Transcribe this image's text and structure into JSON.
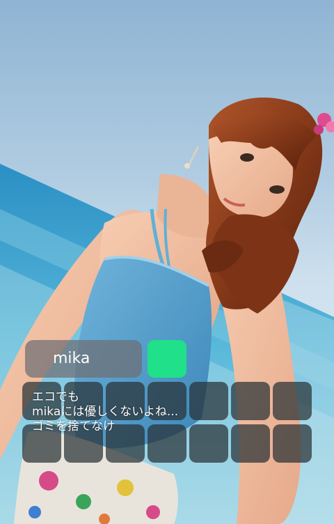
{
  "speaker": {
    "name": "mika"
  },
  "status_color": "#20e08a",
  "message": {
    "lines": [
      "エコでも",
      "mikaには優しくないよね...",
      "ゴミを捨てなけ"
    ]
  },
  "slots": {
    "rows": 2,
    "columns": 7
  }
}
